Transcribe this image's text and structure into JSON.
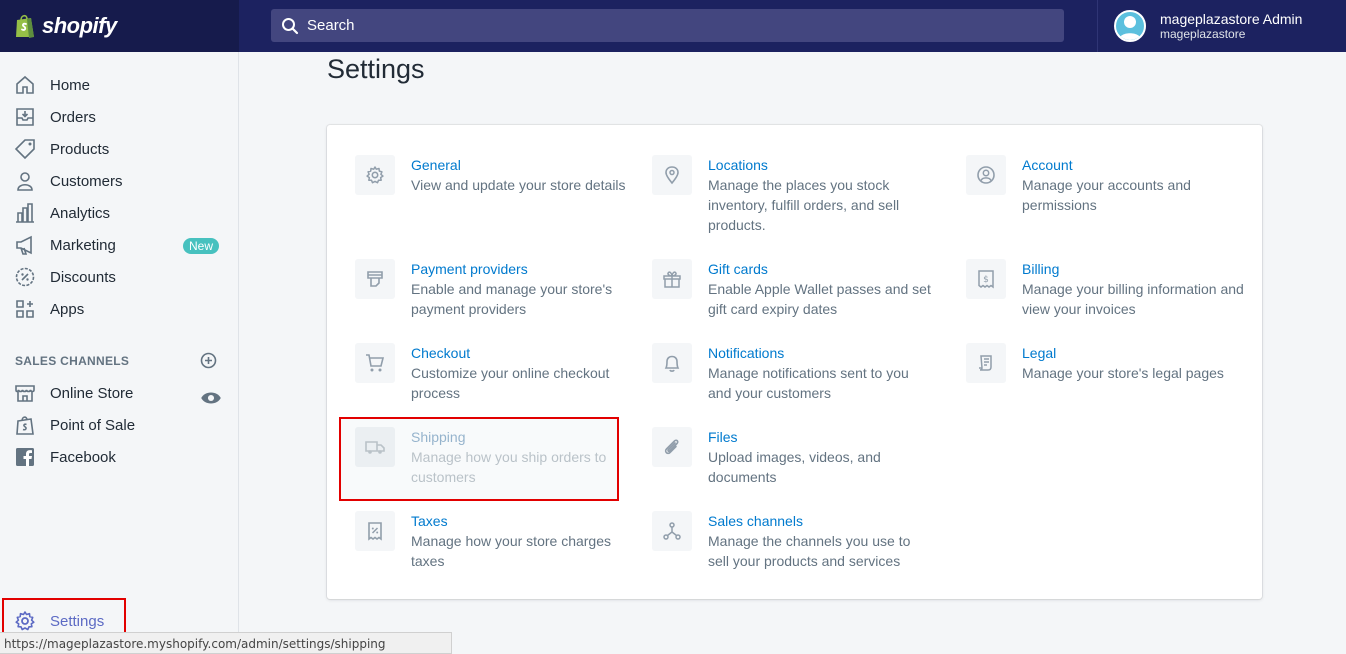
{
  "topbar": {
    "logo_text": "shopify",
    "search_placeholder": "Search",
    "user_name": "mageplazastore Admin",
    "user_store": "mageplazastore"
  },
  "sidebar": {
    "items": [
      {
        "label": "Home",
        "icon": "home-icon"
      },
      {
        "label": "Orders",
        "icon": "orders-icon"
      },
      {
        "label": "Products",
        "icon": "tag-icon"
      },
      {
        "label": "Customers",
        "icon": "person-icon"
      },
      {
        "label": "Analytics",
        "icon": "bar-chart-icon"
      },
      {
        "label": "Marketing",
        "icon": "megaphone-icon",
        "badge": "New"
      },
      {
        "label": "Discounts",
        "icon": "discount-icon"
      },
      {
        "label": "Apps",
        "icon": "apps-icon"
      }
    ],
    "sales_channels_title": "SALES CHANNELS",
    "channels": [
      {
        "label": "Online Store",
        "icon": "store-icon"
      },
      {
        "label": "Point of Sale",
        "icon": "pos-bag-icon"
      },
      {
        "label": "Facebook",
        "icon": "facebook-icon"
      }
    ],
    "settings_label": "Settings"
  },
  "status_url": "https://mageplazastore.myshopify.com/admin/settings/shipping",
  "main": {
    "title": "Settings",
    "settings": [
      {
        "title": "General",
        "desc": "View and update your store details"
      },
      {
        "title": "Locations",
        "desc": "Manage the places you stock inventory, fulfill orders, and sell products."
      },
      {
        "title": "Account",
        "desc": "Manage your accounts and permissions"
      },
      {
        "title": "Payment providers",
        "desc": "Enable and manage your store's payment providers"
      },
      {
        "title": "Gift cards",
        "desc": "Enable Apple Wallet passes and set gift card expiry dates"
      },
      {
        "title": "Billing",
        "desc": "Manage your billing information and view your invoices"
      },
      {
        "title": "Checkout",
        "desc": "Customize your online checkout process"
      },
      {
        "title": "Notifications",
        "desc": "Manage notifications sent to you and your customers"
      },
      {
        "title": "Legal",
        "desc": "Manage your store's legal pages"
      },
      {
        "title": "Shipping",
        "desc": "Manage how you ship orders to customers"
      },
      {
        "title": "Files",
        "desc": "Upload images, videos, and documents"
      },
      {
        "title": "Taxes",
        "desc": "Manage how your store charges taxes"
      },
      {
        "title": "Sales channels",
        "desc": "Manage the channels you use to sell your products and services"
      }
    ]
  },
  "colors": {
    "topbar": "#1c2260",
    "link": "#007ace",
    "highlight": "#e20000",
    "settings_active": "#5c6ac4"
  }
}
